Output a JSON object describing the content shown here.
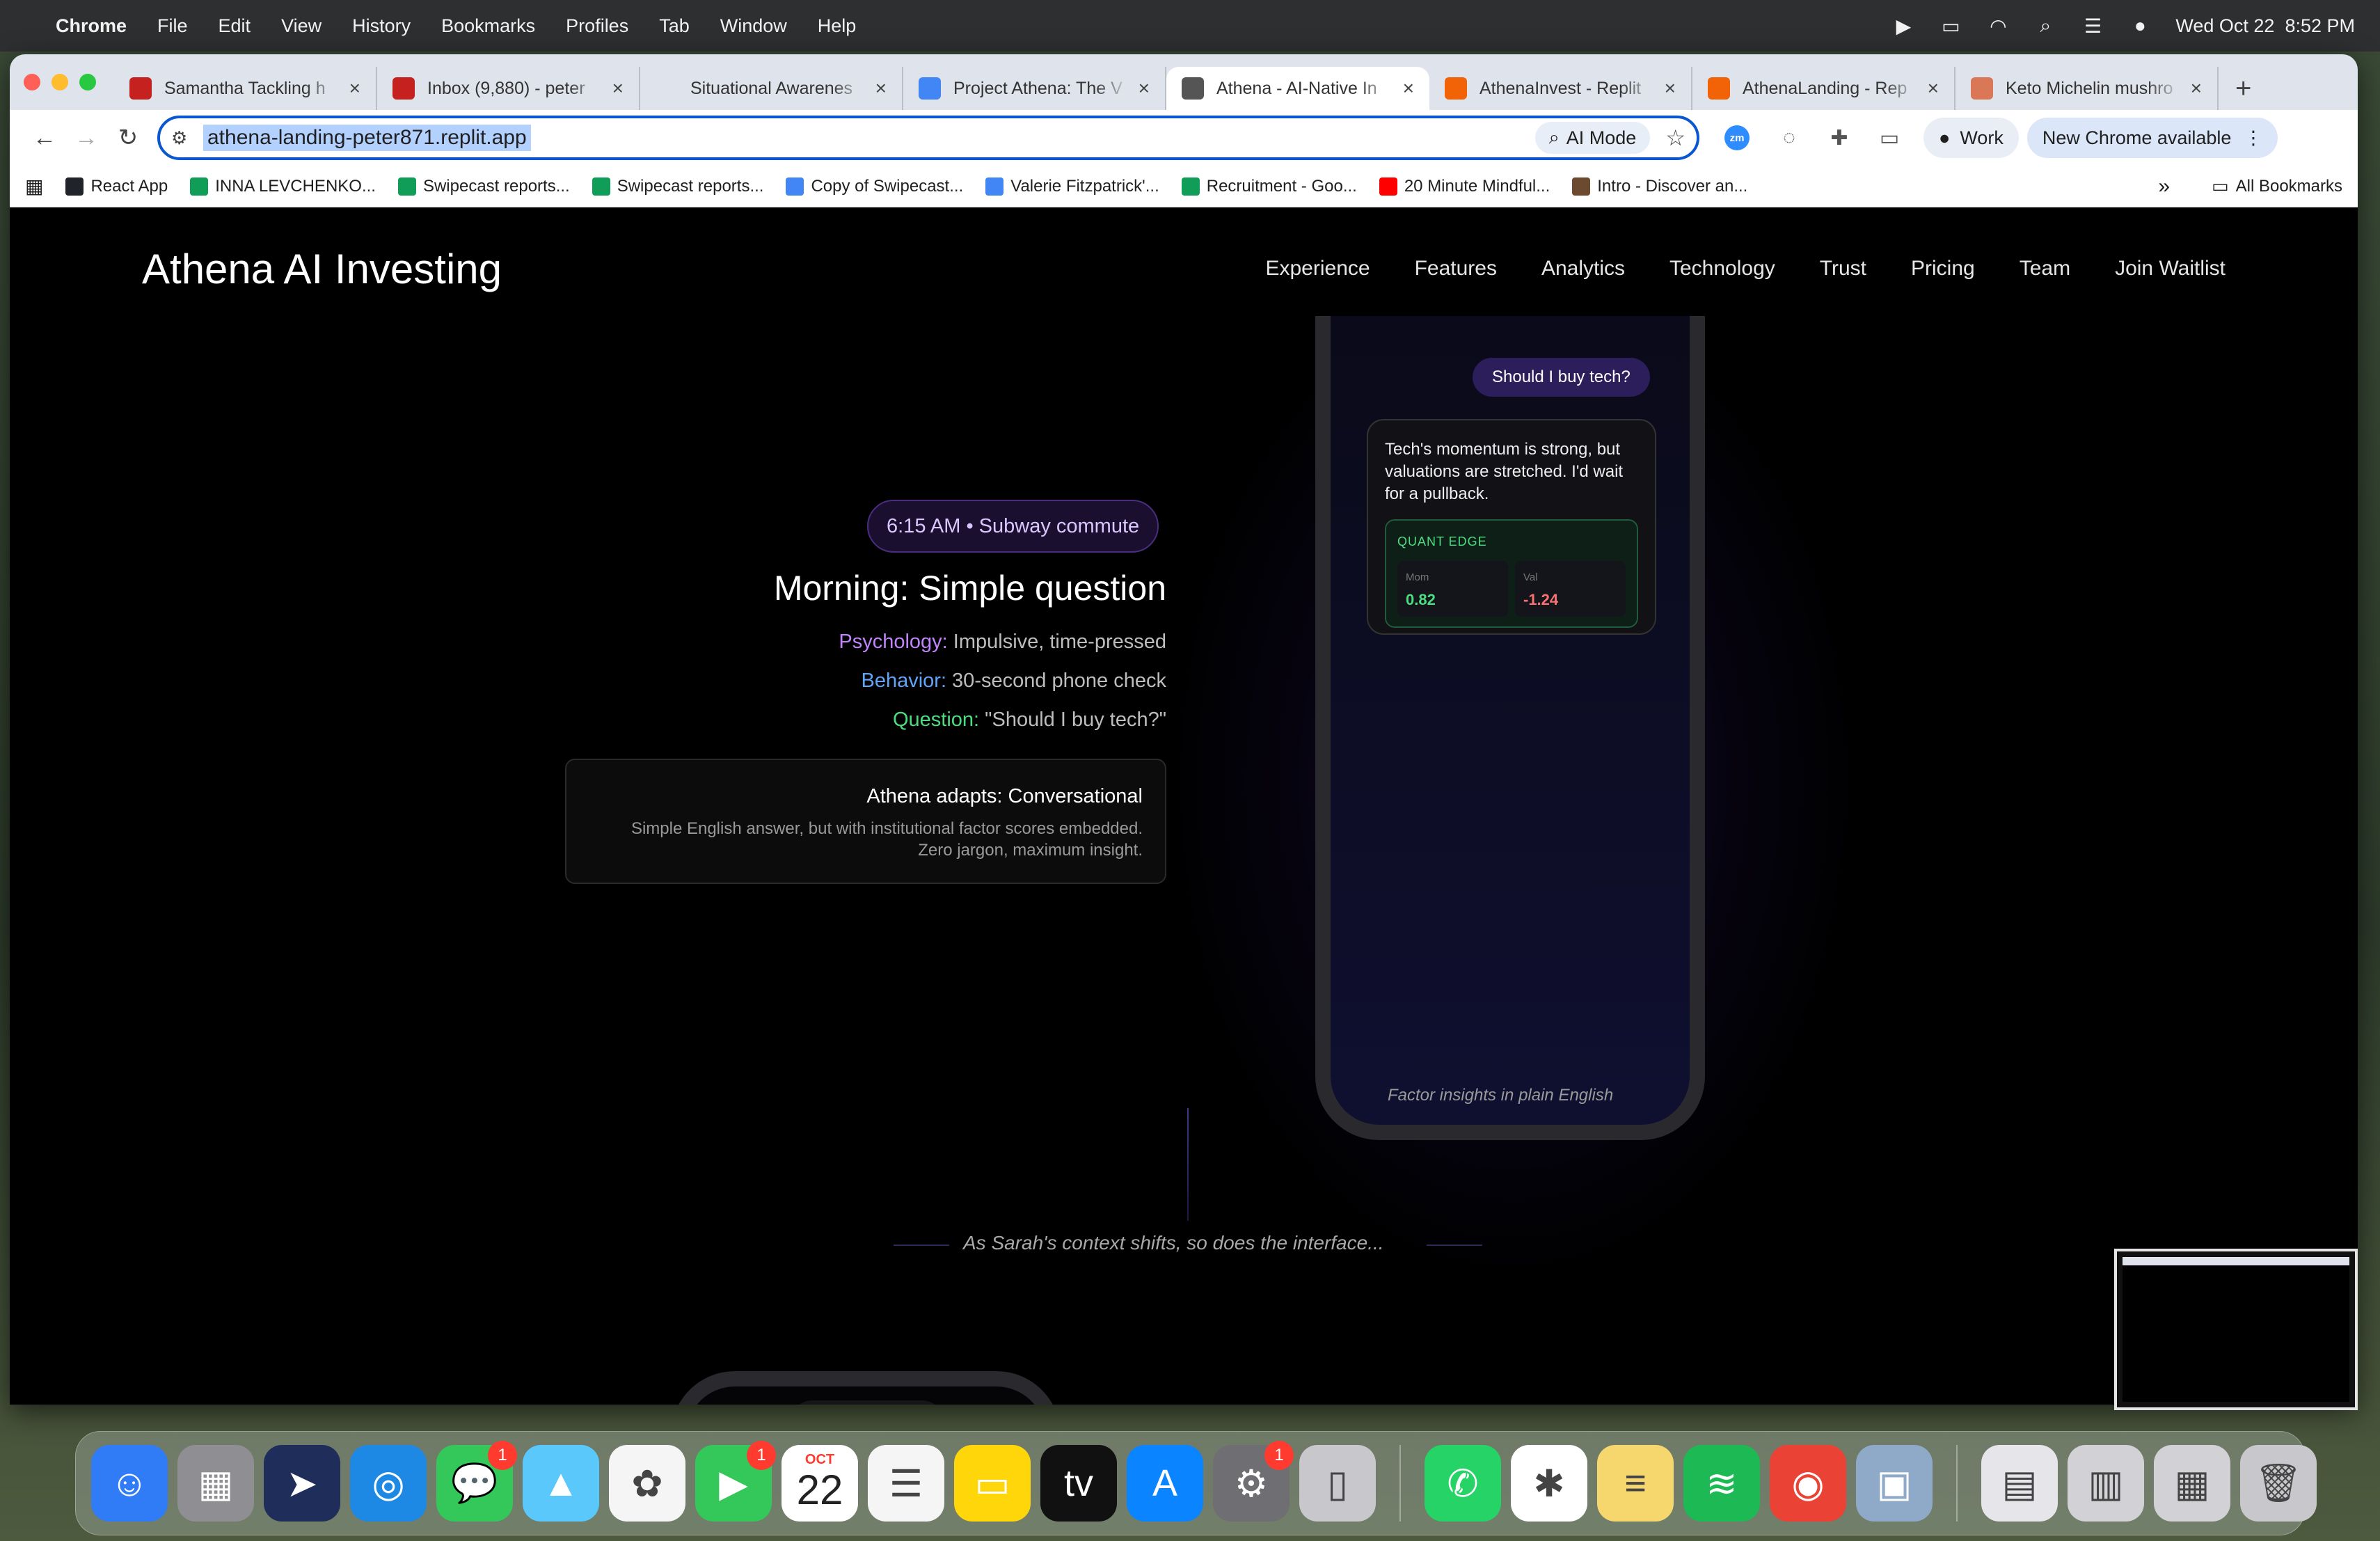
{
  "menubar": {
    "app": "Chrome",
    "items": [
      "File",
      "Edit",
      "View",
      "History",
      "Bookmarks",
      "Profiles",
      "Tab",
      "Window",
      "Help"
    ],
    "clock": "Wed Oct 22  8:52 PM"
  },
  "browser": {
    "tabs": [
      {
        "title": "Samantha Tackling h",
        "icon": "gmail-icon",
        "color": "#c5221f"
      },
      {
        "title": "Inbox (9,880) - peter",
        "icon": "gmail-icon",
        "color": "#c5221f"
      },
      {
        "title": "Situational Awarenes",
        "icon": "blank-icon",
        "color": "#dfe3eb"
      },
      {
        "title": "Project Athena: The V",
        "icon": "google-docs-icon",
        "color": "#4285f4"
      },
      {
        "title": "Athena - AI-Native In",
        "icon": "globe-icon",
        "color": "#555555",
        "active": true
      },
      {
        "title": "AthenaInvest - Replit",
        "icon": "replit-icon",
        "color": "#f26207"
      },
      {
        "title": "AthenaLanding - Rep",
        "icon": "replit-icon",
        "color": "#f26207"
      },
      {
        "title": "Keto Michelin mushro",
        "icon": "claude-icon",
        "color": "#d97757"
      }
    ],
    "url": "athena-landing-peter871.replit.app",
    "ai_mode": "AI Mode",
    "profile": "Work",
    "update": "New Chrome available",
    "bookmarks": [
      {
        "label": "React App",
        "color": "#20232a"
      },
      {
        "label": "INNA LEVCHENKO...",
        "color": "#0f9d58"
      },
      {
        "label": "Swipecast reports...",
        "color": "#0f9d58"
      },
      {
        "label": "Swipecast reports...",
        "color": "#0f9d58"
      },
      {
        "label": "Copy of Swipecast...",
        "color": "#4285f4"
      },
      {
        "label": "Valerie Fitzpatrick'...",
        "color": "#4285f4"
      },
      {
        "label": "Recruitment - Goo...",
        "color": "#0f9d58"
      },
      {
        "label": "20 Minute Mindful...",
        "color": "#ff0000"
      },
      {
        "label": "Intro - Discover an...",
        "color": "#6b4a2f"
      }
    ],
    "all_bookmarks": "All Bookmarks",
    "overflow": "»"
  },
  "site": {
    "logo": "Athena AI Investing",
    "nav": [
      "Experience",
      "Features",
      "Analytics",
      "Technology",
      "Trust",
      "Pricing",
      "Team",
      "Join Waitlist"
    ],
    "phone": {
      "user_msg": "Should I buy tech?",
      "ai_msg": "Tech's momentum is strong, but valuations are stretched. I'd wait for a pullback.",
      "quant_label": "QUANT EDGE",
      "factors": [
        {
          "name": "Mom",
          "value": "0.82",
          "tone": "pos"
        },
        {
          "name": "Val",
          "value": "-1.24",
          "tone": "neg"
        }
      ],
      "caption": "Factor insights in plain English"
    },
    "scene": {
      "time": "6:15 AM • Subway commute",
      "title": "Morning: Simple question",
      "psych_key": "Psychology:",
      "psych_val": " Impulsive, time-pressed",
      "behavior_key": "Behavior:",
      "behavior_val": " 30-second phone check",
      "question_key": "Question:",
      "question_val": " \"Should I buy tech?\"",
      "adapt_title": "Athena adapts: Conversational",
      "adapt_desc1": "Simple English answer, but with institutional factor scores embedded.",
      "adapt_desc2": "Zero jargon, maximum insight."
    },
    "transition": "As Sarah's context shifts, so does the interface..."
  },
  "dock": [
    {
      "name": "finder-icon",
      "glyph": "☺",
      "color": "#2f7cf6"
    },
    {
      "name": "launchpad-icon",
      "glyph": "▦",
      "color": "#8e8e93"
    },
    {
      "name": "copilot-icon",
      "glyph": "➤",
      "color": "#1f2d5a"
    },
    {
      "name": "safari-icon",
      "glyph": "◎",
      "color": "#1e88e5"
    },
    {
      "name": "messages-icon",
      "glyph": "💬",
      "color": "#34c759",
      "badge": "1"
    },
    {
      "name": "maps-icon",
      "glyph": "▲",
      "color": "#5ac8fa"
    },
    {
      "name": "photos-icon",
      "glyph": "✿",
      "color": "#f5f5f5"
    },
    {
      "name": "facetime-icon",
      "glyph": "▶",
      "color": "#34c759",
      "badge": "1"
    },
    {
      "name": "calendar-icon",
      "glyph": "",
      "color": "#ffffff",
      "month": "OCT",
      "day": "22"
    },
    {
      "name": "reminders-icon",
      "glyph": "☰",
      "color": "#f5f5f5"
    },
    {
      "name": "notes-icon",
      "glyph": "▭",
      "color": "#ffd60a"
    },
    {
      "name": "apple-tv-icon",
      "glyph": "tv",
      "color": "#111111"
    },
    {
      "name": "app-store-icon",
      "glyph": "A",
      "color": "#0a84ff"
    },
    {
      "name": "system-settings-icon",
      "glyph": "⚙",
      "color": "#6e6e73",
      "badge": "1"
    },
    {
      "name": "iphone-mirroring-icon",
      "glyph": "▯",
      "color": "#c7c7cc"
    },
    {
      "name": "whatsapp-icon",
      "glyph": "✆",
      "color": "#25d366"
    },
    {
      "name": "slack-icon",
      "glyph": "✱",
      "color": "#ffffff"
    },
    {
      "name": "stickies-icon",
      "glyph": "≡",
      "color": "#f5d76e"
    },
    {
      "name": "spotify-icon",
      "glyph": "≋",
      "color": "#1db954"
    },
    {
      "name": "chrome-icon",
      "glyph": "◉",
      "color": "#ea4335"
    },
    {
      "name": "preview-icon",
      "glyph": "▣",
      "color": "#8fa9c9"
    },
    {
      "name": "document-stack-icon",
      "glyph": "▤",
      "color": "#e5e5ea"
    },
    {
      "name": "screenshot-stack-icon",
      "glyph": "▥",
      "color": "#d1d1d6"
    },
    {
      "name": "downloads-stack-icon",
      "glyph": "▦",
      "color": "#d1d1d6"
    },
    {
      "name": "trash-icon",
      "glyph": "🗑",
      "color": "#c7c7cc"
    }
  ]
}
